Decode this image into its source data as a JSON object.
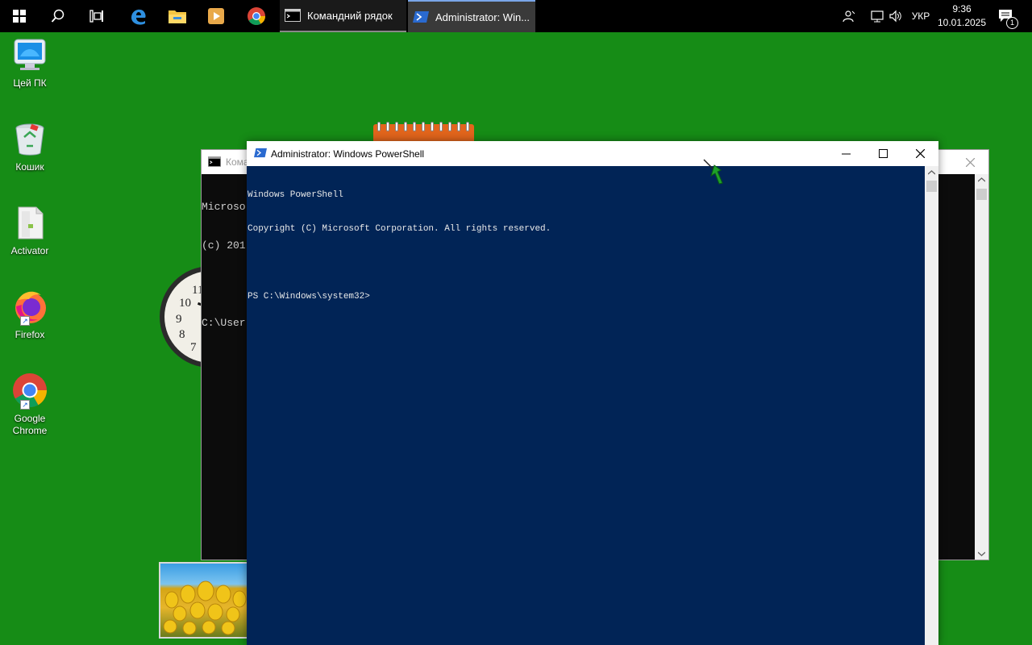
{
  "taskbar": {
    "icons": [
      "start-icon",
      "search-icon",
      "task-view-icon",
      "edge-icon",
      "file-explorer-icon",
      "media-player-icon",
      "chrome-icon"
    ],
    "tasks": [
      {
        "label": "Командний рядок",
        "icon": "cmd-icon"
      },
      {
        "label": "Administrator: Win...",
        "icon": "powershell-icon"
      }
    ],
    "tray": {
      "language": "УКР",
      "time": "9:36",
      "date": "10.01.2025",
      "notifications_count": "1"
    }
  },
  "desktop": {
    "icons": [
      {
        "label": "Цей ПК",
        "icon": "computer-icon"
      },
      {
        "label": "Кошик",
        "icon": "recycle-bin-icon"
      },
      {
        "label": "Activator",
        "icon": "file-icon"
      },
      {
        "label": "Firefox",
        "icon": "firefox-icon"
      },
      {
        "label": "Google Chrome",
        "icon": "chrome-icon"
      }
    ]
  },
  "cmd_window": {
    "title": "Кома",
    "lines": [
      "Microso",
      "(c) 201",
      "",
      "C:\\User"
    ]
  },
  "ps_window": {
    "title": "Administrator: Windows PowerShell",
    "console_lines": [
      "Windows PowerShell",
      "Copyright (C) Microsoft Corporation. All rights reserved.",
      "",
      "PS C:\\Windows\\system32>"
    ]
  },
  "colors": {
    "desktop_bg": "#168c16",
    "powershell_bg": "#012456",
    "cmd_bg": "#0c0c0c",
    "taskbar_bg": "#000000",
    "notepad_gadget": "#e2651c"
  },
  "clock_gadget_numbers": [
    "11",
    "10",
    "9",
    "8",
    "7"
  ]
}
